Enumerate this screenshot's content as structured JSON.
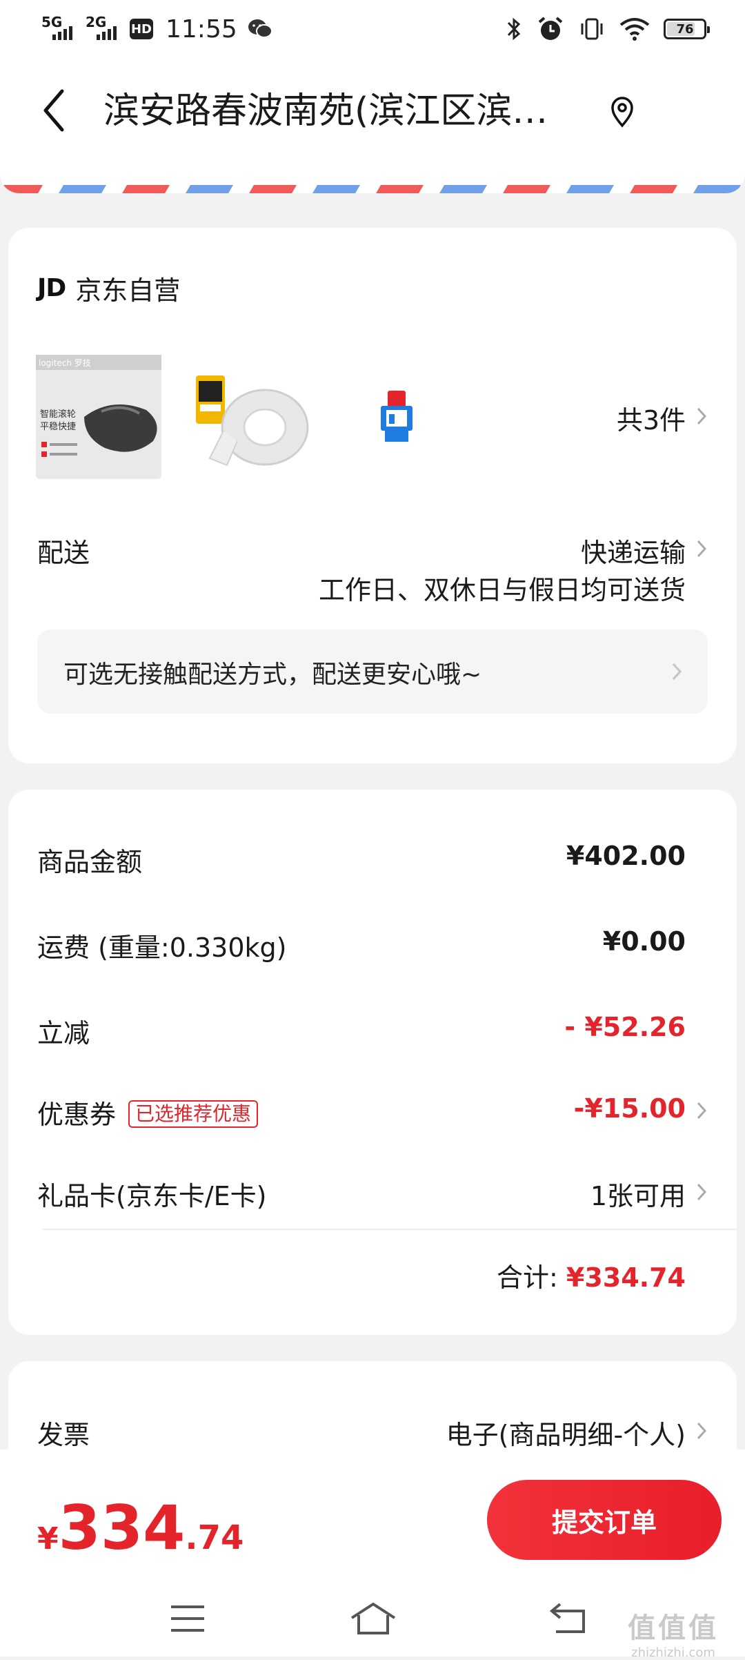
{
  "status_bar": {
    "net1": "5G",
    "net2": "2G",
    "hd": "HD",
    "time": "11:55",
    "battery": "76",
    "battery_level": 0.76
  },
  "header": {
    "address": "滨安路春波南苑(滨江区滨…"
  },
  "shop": {
    "logo": "JD",
    "name": "京东自营",
    "count": "共3件"
  },
  "delivery": {
    "label": "配送",
    "method": "快递运输",
    "note": "工作日、双休日与假日均可送货",
    "notice": "可选无接触配送方式，配送更安心哦~"
  },
  "summary": {
    "goods_label": "商品金额",
    "goods_value": "¥402.00",
    "freight_label": "运费  (重量:0.330kg)",
    "freight_value": "¥0.00",
    "discount_label": "立减",
    "discount_value": "- ¥52.26",
    "coupon_label": "优惠券",
    "coupon_tag": "已选推荐优惠",
    "coupon_value": "-¥15.00",
    "giftcard_label": "礼品卡(京东卡/E卡)",
    "giftcard_value": "1张可用",
    "total_label": "合计:",
    "total_value": "¥334.74"
  },
  "invoice": {
    "label": "发票",
    "value": "电子(商品明细-个人)"
  },
  "footer": {
    "currency": "¥",
    "total_int": "334",
    "total_dec": ".74",
    "submit_label": "提交订单"
  },
  "products": [
    {
      "name": "mouse-product",
      "box_text": "智能滚轮 平稳快捷",
      "brand": "logitech 罗技"
    },
    {
      "name": "tape-product"
    },
    {
      "name": "adapter-product"
    }
  ],
  "watermark": {
    "main": "值值值",
    "sub": "zhizhizhi.com"
  },
  "colors": {
    "accent_red": "#e3242b",
    "airmail_red": "#f05a5a",
    "airmail_blue": "#6fa0e8"
  }
}
